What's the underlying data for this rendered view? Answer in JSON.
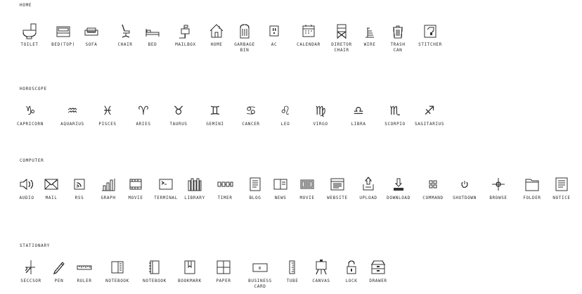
{
  "sections": [
    {
      "title": "HOME",
      "items": [
        {
          "label": "TOILET",
          "icon": "toilet-icon"
        },
        {
          "label": "BED(TOP)",
          "icon": "bed-top-icon"
        },
        {
          "label": "SOFA",
          "icon": "sofa-icon"
        },
        {
          "label": "CHAIR",
          "icon": "chair-icon"
        },
        {
          "label": "BED",
          "icon": "bed-icon"
        },
        {
          "label": "MAILBOX",
          "icon": "mailbox-icon"
        },
        {
          "label": "HOME",
          "icon": "home-icon"
        },
        {
          "label": "GARBAGE\nBIN",
          "icon": "garbage-bin-icon"
        },
        {
          "label": "AC",
          "icon": "ac-icon"
        },
        {
          "label": "CALENDAR",
          "icon": "calendar-icon"
        },
        {
          "label": "DIRETOR\nCHAIR",
          "icon": "director-chair-icon"
        },
        {
          "label": "WIRE",
          "icon": "wire-icon"
        },
        {
          "label": "TRASH\nCAN",
          "icon": "trash-can-icon"
        },
        {
          "label": "STITCHER",
          "icon": "stitcher-icon"
        }
      ]
    },
    {
      "title": "HOROSCOPE",
      "items": [
        {
          "label": "CAPRICORN",
          "icon": "capricorn-icon",
          "glyph": "♑"
        },
        {
          "label": "AQUARIUS",
          "icon": "aquarius-icon",
          "glyph": "♒"
        },
        {
          "label": "PISCES",
          "icon": "pisces-icon",
          "glyph": "♓"
        },
        {
          "label": "ARIES",
          "icon": "aries-icon",
          "glyph": "♈"
        },
        {
          "label": "TAURUS",
          "icon": "taurus-icon",
          "glyph": "♉"
        },
        {
          "label": "GEMINI",
          "icon": "gemini-icon",
          "glyph": "♊"
        },
        {
          "label": "CANCER",
          "icon": "cancer-icon",
          "glyph": "♋"
        },
        {
          "label": "LEO",
          "icon": "leo-icon",
          "glyph": "♌"
        },
        {
          "label": "VIRGO",
          "icon": "virgo-icon",
          "glyph": "♍"
        },
        {
          "label": "LIBRA",
          "icon": "libra-icon",
          "glyph": "♎"
        },
        {
          "label": "SCORPIO",
          "icon": "scorpio-icon",
          "glyph": "♏"
        },
        {
          "label": "SAGITARIUS",
          "icon": "sagittarius-icon",
          "glyph": "♐"
        }
      ]
    },
    {
      "title": "COMPUTER",
      "items": [
        {
          "label": "AUDIO",
          "icon": "audio-icon"
        },
        {
          "label": "MAIL",
          "icon": "mail-icon"
        },
        {
          "label": "RSS",
          "icon": "rss-icon"
        },
        {
          "label": "GRAPH",
          "icon": "graph-icon"
        },
        {
          "label": "MOVIE",
          "icon": "movie-icon"
        },
        {
          "label": "TERMINAL",
          "icon": "terminal-icon"
        },
        {
          "label": "LIBRARY",
          "icon": "library-icon"
        },
        {
          "label": "TIMER",
          "icon": "timer-icon"
        },
        {
          "label": "BLOG",
          "icon": "blog-icon"
        },
        {
          "label": "NEWS",
          "icon": "news-icon"
        },
        {
          "label": "MOVIE",
          "icon": "movie-screen-icon"
        },
        {
          "label": "WEBSITE",
          "icon": "website-icon"
        },
        {
          "label": "UPLOAD",
          "icon": "upload-icon"
        },
        {
          "label": "DOWNLOAD",
          "icon": "download-icon"
        },
        {
          "label": "COMMAND",
          "icon": "command-icon"
        },
        {
          "label": "SHUTDOWN",
          "icon": "shutdown-icon"
        },
        {
          "label": "BROWSE",
          "icon": "browse-icon"
        },
        {
          "label": "FOLDER",
          "icon": "folder-icon"
        },
        {
          "label": "NOTICE",
          "icon": "notice-icon"
        }
      ]
    },
    {
      "title": "STATIONARY",
      "items": [
        {
          "label": "SECCSOR",
          "icon": "scissors-icon"
        },
        {
          "label": "PEN",
          "icon": "pen-icon"
        },
        {
          "label": "RULER",
          "icon": "ruler-icon"
        },
        {
          "label": "NOTEBOOK",
          "icon": "notebook-icon"
        },
        {
          "label": "NOTEBOOK",
          "icon": "notebook-spiral-icon"
        },
        {
          "label": "BOOKMARK",
          "icon": "bookmark-icon"
        },
        {
          "label": "PAPER",
          "icon": "paper-icon"
        },
        {
          "label": "BUSINESS\nCARD",
          "icon": "business-card-icon"
        },
        {
          "label": "TUBE",
          "icon": "tube-icon"
        },
        {
          "label": "CANVAS",
          "icon": "canvas-icon"
        },
        {
          "label": "LOCK",
          "icon": "lock-icon"
        },
        {
          "label": "DRAWER",
          "icon": "drawer-icon"
        }
      ]
    }
  ]
}
